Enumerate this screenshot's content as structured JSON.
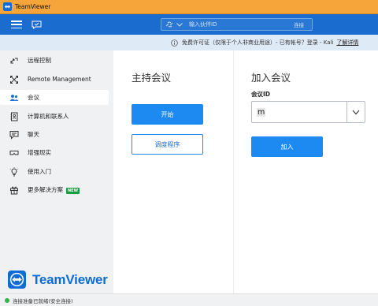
{
  "window": {
    "title": "TeamViewer"
  },
  "toolbar": {
    "partner_placeholder": "输入伙伴ID",
    "connect_label": "连接"
  },
  "infobar": {
    "license_text": "免费许可证（仅限于个人非商业用途）- 已有帐号？登录 - Kali",
    "more_link": "了解详情"
  },
  "sidebar": {
    "items": [
      {
        "label": "远程控制",
        "icon": "arrows-icon"
      },
      {
        "label": "Remote Management",
        "icon": "expand-icon"
      },
      {
        "label": "会议",
        "icon": "people-icon"
      },
      {
        "label": "计算机和联系人",
        "icon": "contacts-icon"
      },
      {
        "label": "聊天",
        "icon": "chat-icon"
      },
      {
        "label": "增强现实",
        "icon": "ar-glasses-icon"
      },
      {
        "label": "使用入门",
        "icon": "lightbulb-icon"
      },
      {
        "label": "更多解决方案",
        "icon": "gift-icon",
        "badge": "NEW"
      }
    ],
    "active_index": 2
  },
  "brand": {
    "wordmark": "TeamViewer"
  },
  "host": {
    "heading": "主持会议",
    "start_label": "开始",
    "schedule_label": "调度程序"
  },
  "join": {
    "heading": "加入会议",
    "meeting_id_label": "会议ID",
    "meeting_id_value": "m",
    "join_label": "加入"
  },
  "status": {
    "text": "连接准备已就绪(安全连接)"
  },
  "colors": {
    "titlebar": "#f5a53a",
    "toolbar": "#1b6ccf",
    "accent": "#1d8af2",
    "brand": "#0e6dd4",
    "status_ok": "#35b24a"
  }
}
